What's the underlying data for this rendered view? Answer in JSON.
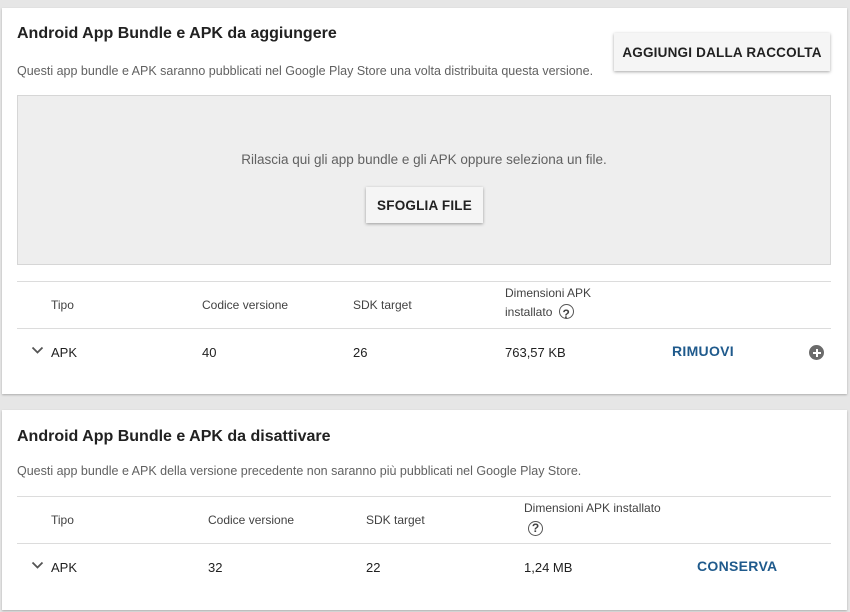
{
  "add_section": {
    "title": "Android App Bundle e APK da aggiungere",
    "description": "Questi app bundle e APK saranno pubblicati nel Google Play Store una volta distribuita questa versione.",
    "add_from_library_label": "AGGIUNGI DALLA RACCOLTA",
    "dropzone": {
      "text": "Rilascia qui gli app bundle e gli APK oppure seleziona un file.",
      "browse_label": "SFOGLIA FILE"
    },
    "columns": {
      "type": "Tipo",
      "version_code": "Codice versione",
      "target_sdk": "SDK target",
      "size_line1": "Dimensioni APK",
      "size_line2": "installato"
    },
    "row": {
      "type": "APK",
      "version_code": "40",
      "target_sdk": "26",
      "size": "763,57 KB",
      "action_label": "RIMUOVI"
    }
  },
  "deactivate_section": {
    "title": "Android App Bundle e APK da disattivare",
    "description": "Questi app bundle e APK della versione precedente non saranno più pubblicati nel Google Play Store.",
    "columns": {
      "type": "Tipo",
      "version_code": "Codice versione",
      "target_sdk": "SDK target",
      "size": "Dimensioni APK installato"
    },
    "row": {
      "type": "APK",
      "version_code": "32",
      "target_sdk": "22",
      "size": "1,24 MB",
      "action_label": "CONSERVA"
    }
  },
  "icons": {
    "help": "help-circle-icon",
    "expand": "chevron-down-icon",
    "add": "add-circle-icon"
  },
  "colors": {
    "link_blue": "#1f5a8c",
    "dropzone_bg": "#eeeeee",
    "page_bg": "#e6e6e6"
  }
}
